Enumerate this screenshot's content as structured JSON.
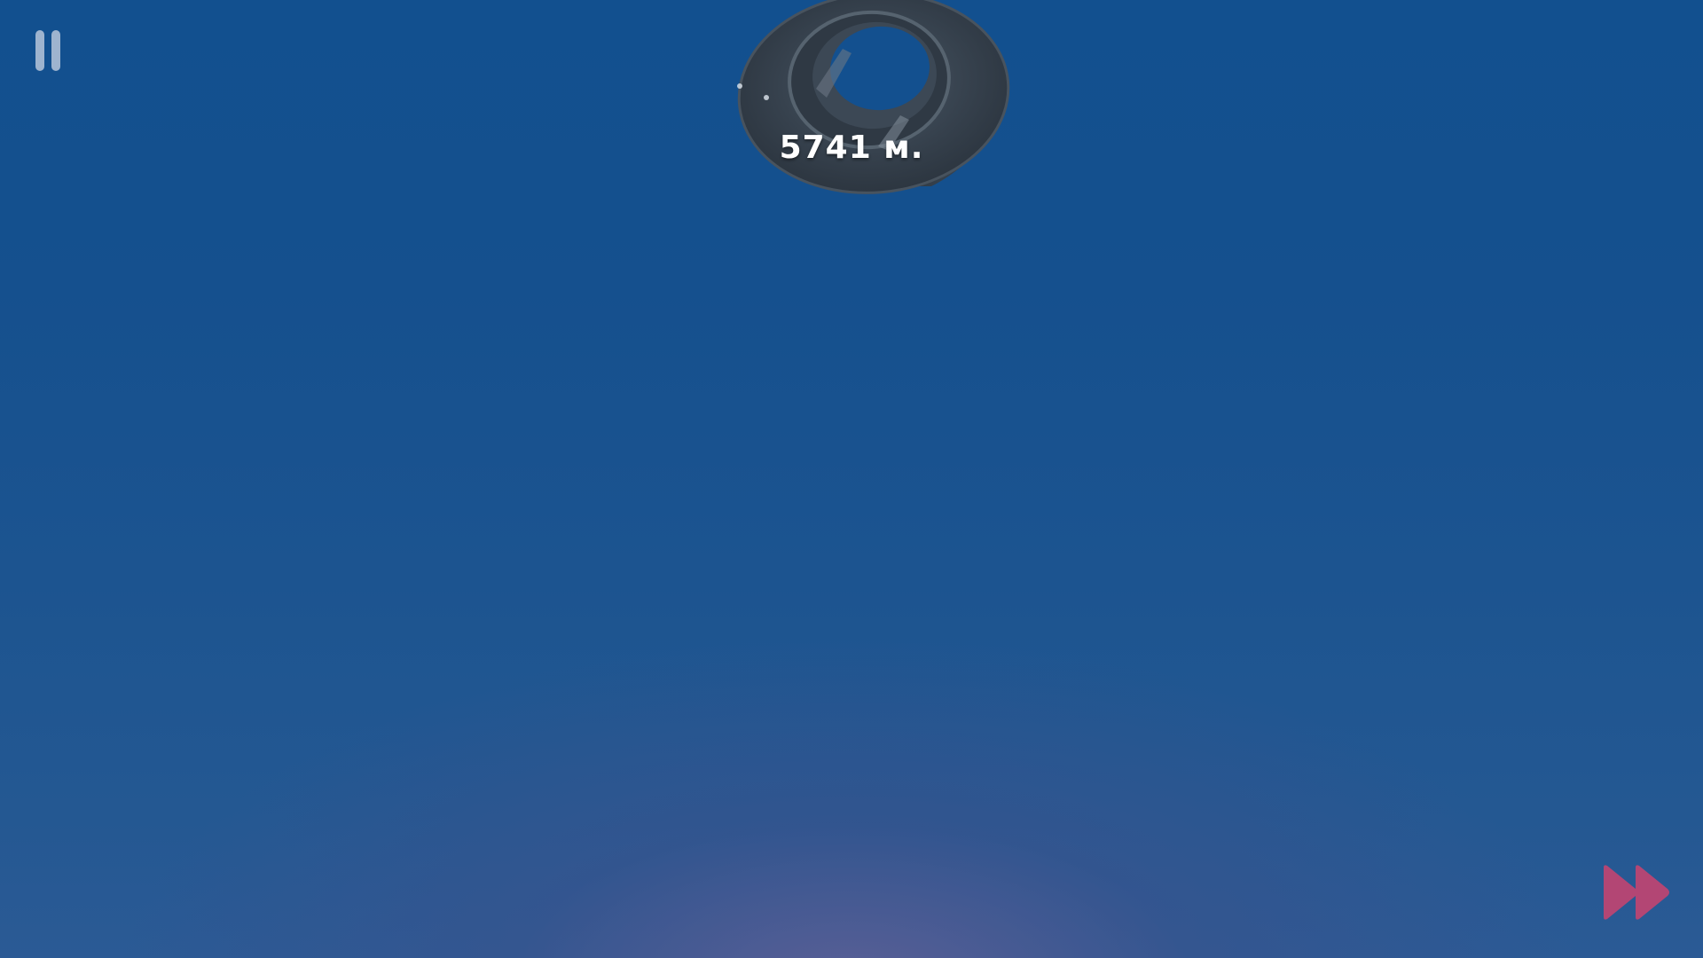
{
  "hud": {
    "distance_label": "5741 м.",
    "pause_icon": "pause-icon",
    "fast_forward_icon": "fast-forward-icon"
  },
  "scene": {
    "object": "tire",
    "colors": {
      "sky_top": "#12508f",
      "sky_bottom": "#2b5a95",
      "horizon_glow": "#62609a",
      "pause": "#aebfd6",
      "fast_forward": "#b34674",
      "tire": "#3a4552"
    }
  }
}
